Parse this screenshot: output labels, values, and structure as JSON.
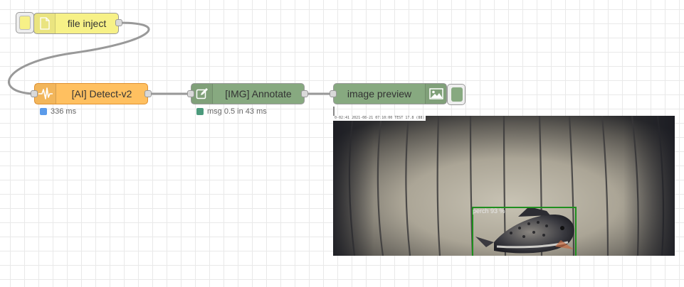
{
  "nodes": {
    "file_inject": {
      "label": "file inject",
      "icon": "file-icon",
      "color": "#f7f187"
    },
    "detect": {
      "label": "[AI] Detect-v2",
      "icon": "waveform-icon",
      "color": "#ffc060",
      "status": {
        "text": "336 ms",
        "color": "#5b9bea"
      }
    },
    "annotate": {
      "label": "[IMG] Annotate",
      "icon": "pencil-square-icon",
      "color": "#87a980",
      "status": {
        "text": "msg 0.5 in 43 ms",
        "color": "#4c9a7c"
      }
    },
    "preview": {
      "label": "image preview",
      "icon": "image-icon",
      "color": "#87a980"
    }
  },
  "preview_image": {
    "stamp": "0-02:41 2021-08-21 07:10:00 TEST 17.8 (88)",
    "detections": [
      {
        "label": "perch 93 %",
        "color": "#1f8f1f"
      }
    ]
  }
}
